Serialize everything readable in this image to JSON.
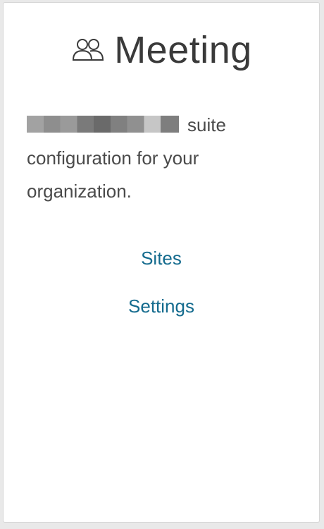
{
  "card": {
    "title": "Meeting",
    "icon": "users-icon",
    "description_suffix": "suite",
    "description_rest": "configuration for your organization.",
    "links": [
      {
        "label": "Sites"
      },
      {
        "label": "Settings"
      }
    ]
  },
  "colors": {
    "link": "#146b8e",
    "title": "#3a3a3a",
    "text": "#4a4a4a",
    "background": "#ffffff"
  }
}
